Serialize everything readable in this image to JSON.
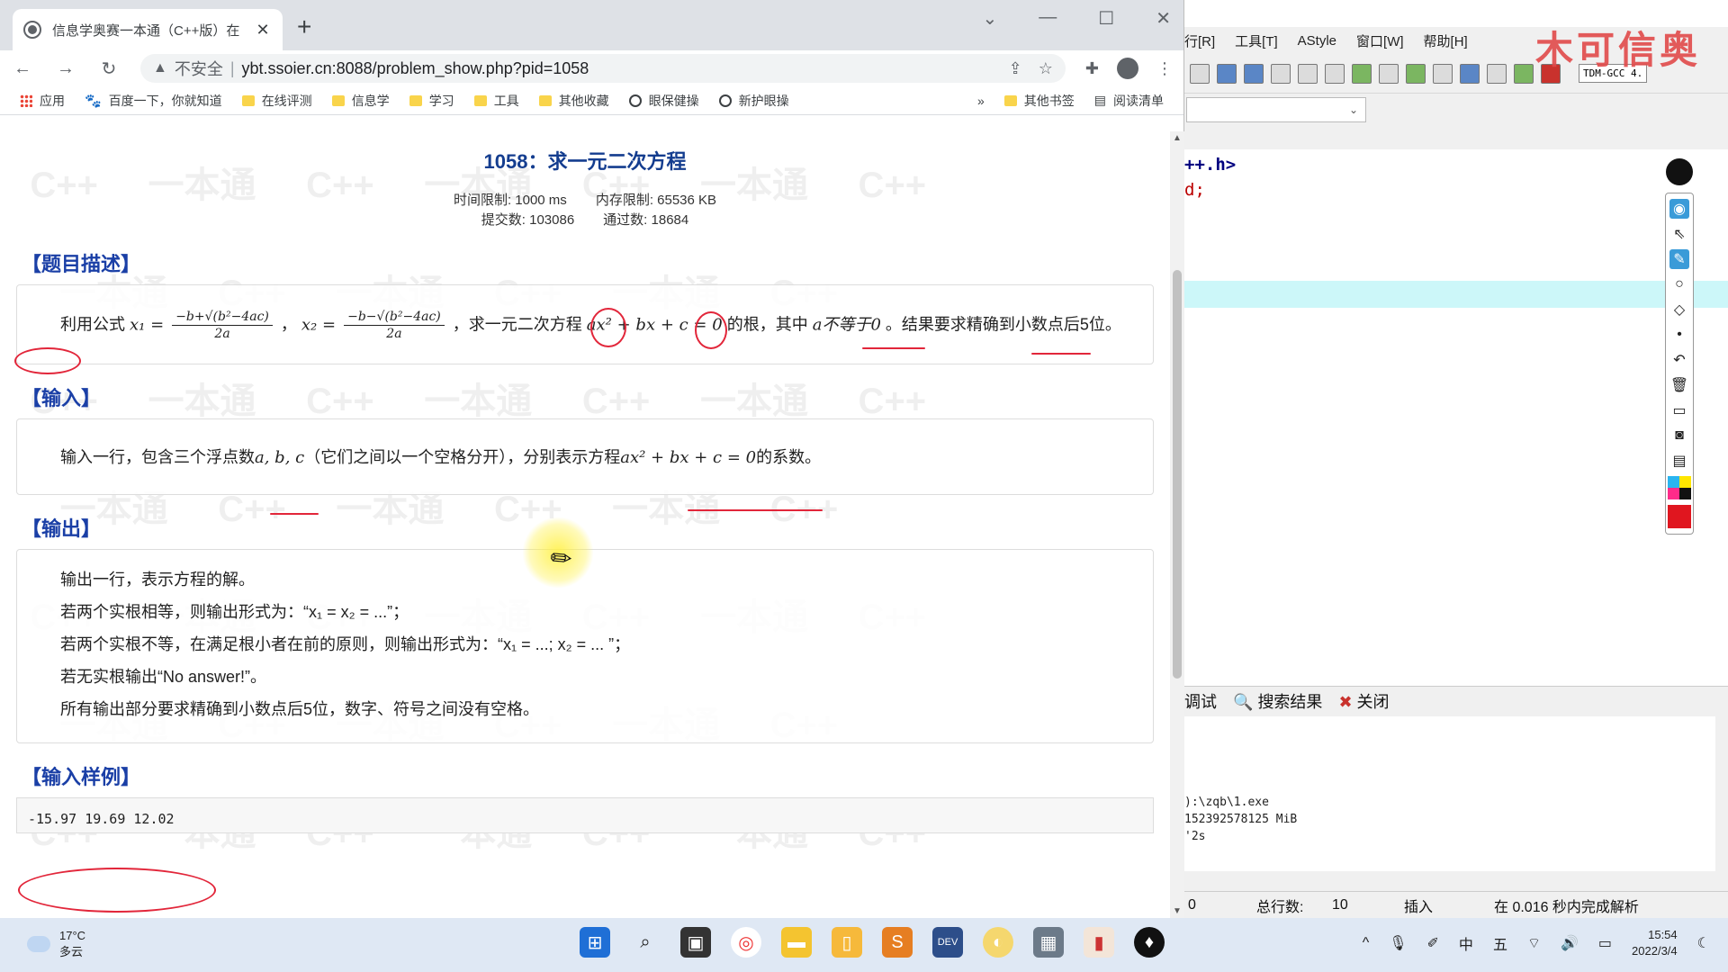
{
  "browser": {
    "tab_title": "信息学奥赛一本通（C++版）在",
    "tab_close": "✕",
    "new_tab": "+",
    "win_min": "—",
    "win_max": "☐",
    "win_close": "✕",
    "nav": {
      "back": "←",
      "forward": "→",
      "reload": "↻"
    },
    "address": {
      "warning_icon": "▲",
      "insecure_label": "不安全",
      "separator": "|",
      "url": "ybt.ssoier.cn:8088/problem_show.php?pid=1058"
    },
    "bookmarks": [
      {
        "label": "应用",
        "icon": "apps-grid"
      },
      {
        "label": "百度一下，你就知道",
        "icon": "baidu-paw"
      },
      {
        "label": "在线评测",
        "icon": "folder"
      },
      {
        "label": "信息学",
        "icon": "folder"
      },
      {
        "label": "学习",
        "icon": "folder"
      },
      {
        "label": "工具",
        "icon": "folder"
      },
      {
        "label": "其他收藏",
        "icon": "folder"
      },
      {
        "label": "眼保健操",
        "icon": "globe"
      },
      {
        "label": "新护眼操",
        "icon": "globe"
      }
    ],
    "bookmarks_more": "»",
    "other_bookmarks": "其他书签",
    "reading_list": "阅读清单"
  },
  "problem": {
    "title": "1058：求一元二次方程",
    "time_limit": "时间限制: 1000 ms",
    "memory_limit": "内存限制: 65536 KB",
    "submissions": "提交数: 103086",
    "accepted": "通过数: 18684",
    "sections": {
      "description": "【题目描述】",
      "input": "【输入】",
      "output": "【输出】",
      "sample_input": "【输入样例】"
    },
    "description": {
      "prefix": "利用公式",
      "x1": "x₁ =",
      "frac_num": "−b+√(b²−4ac)",
      "frac_num2": "−b−√(b²−4ac)",
      "frac_den": "2a",
      "comma": "，",
      "x2": "x₂ =",
      "middle": "，求一元二次方程",
      "equation": "ax² + bx + c = 0",
      "after_eq": "的根，其中",
      "a_nonzero": "a不等于0",
      "suffix": "。结果要求精确到小数点后5位。"
    },
    "input_text": {
      "prefix": "输入一行，包含三个浮点数",
      "vars": "a, b, c",
      "middle": "（它们之间以一个空格分开），分别表示方程",
      "equation": "ax² + bx + c = 0",
      "suffix": "的系数。"
    },
    "output_lines": [
      "输出一行，表示方程的解。",
      "若两个实根相等，则输出形式为：“x₁ = x₂ = ...”；",
      "若两个实根不等，在满足根小者在前的原则，则输出形式为：“x₁ = ...; x₂ = ... ”；",
      "若无实根输出“No answer!”。",
      "所有输出部分要求精确到小数点后5位，数字、符号之间没有空格。"
    ],
    "sample_input": "-15.97 19.69 12.02"
  },
  "ide": {
    "menu": [
      "行[R]",
      "工具[T]",
      "AStyle",
      "窗口[W]",
      "帮助[H]"
    ],
    "compiler": "TDM-GCC 4.",
    "combo_arrow": "⌄",
    "code_line1": "++.h>",
    "code_line2": "d;",
    "logo": "木可信奥",
    "bottom_tabs": [
      "调试",
      "搜索结果",
      "关闭"
    ],
    "console_lines": [
      "):\\zqb\\1.exe",
      "152392578125 MiB",
      "'2s"
    ],
    "status": {
      "line_no": "0",
      "total_lines_label": "总行数:",
      "total_lines": "10",
      "mode": "插入",
      "parse": "在 0.016 秒内完成解析"
    }
  },
  "taskbar": {
    "temp": "17°C",
    "weather": "多云",
    "time": "15:54",
    "date": "2022/3/4",
    "ime": "中",
    "weekday": "五"
  },
  "colors": {
    "title_blue": "#143d8f",
    "section_blue": "#1a3fa6",
    "annotation_red": "#e2263a",
    "ide_highlight": "#ccf7f9"
  }
}
